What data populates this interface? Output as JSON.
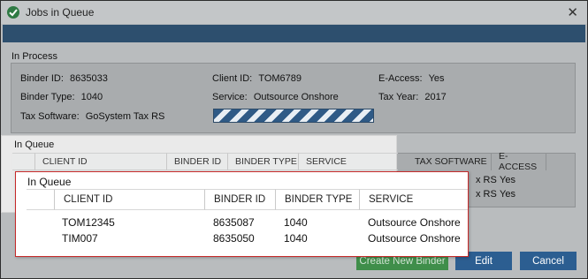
{
  "window": {
    "title": "Jobs in Queue"
  },
  "in_process": {
    "label": "In Process",
    "binder_id": {
      "label": "Binder ID:",
      "value": "8635033"
    },
    "client_id": {
      "label": "Client ID:",
      "value": "TOM6789"
    },
    "e_access": {
      "label": "E-Access:",
      "value": "Yes"
    },
    "binder_type": {
      "label": "Binder Type:",
      "value": "1040"
    },
    "service": {
      "label": "Service:",
      "value": "Outsource Onshore"
    },
    "tax_year": {
      "label": "Tax Year:",
      "value": "2017"
    },
    "tax_software": {
      "label": "Tax Software:",
      "value": "GoSystem Tax RS"
    }
  },
  "queue": {
    "label": "In Queue",
    "columns": [
      "CLIENT ID",
      "BINDER ID",
      "BINDER TYPE",
      "SERVICE",
      "TAX SOFTWARE",
      "E-ACCESS"
    ],
    "background_rows": [
      {
        "tax_software_partial": "x RS",
        "e_access": "Yes"
      },
      {
        "tax_software_partial": "x RS",
        "e_access": "Yes"
      }
    ]
  },
  "drag_panel": {
    "title": "In Queue",
    "columns": [
      "CLIENT ID",
      "BINDER ID",
      "BINDER TYPE",
      "SERVICE"
    ],
    "rows": [
      {
        "client_id": "TOM12345",
        "binder_id": "8635087",
        "binder_type": "1040",
        "service": "Outsource Onshore"
      },
      {
        "client_id": "TIM007",
        "binder_id": "8635050",
        "binder_type": "1040",
        "service": "Outsource Onshore"
      }
    ]
  },
  "buttons": {
    "create": "Create New Binder",
    "edit": "Edit",
    "cancel": "Cancel"
  },
  "colors": {
    "header_blue": "#2d4f6e",
    "button_blue": "#2c5e91",
    "button_green": "#3f8e4a",
    "drag_border": "#c62a2a"
  }
}
